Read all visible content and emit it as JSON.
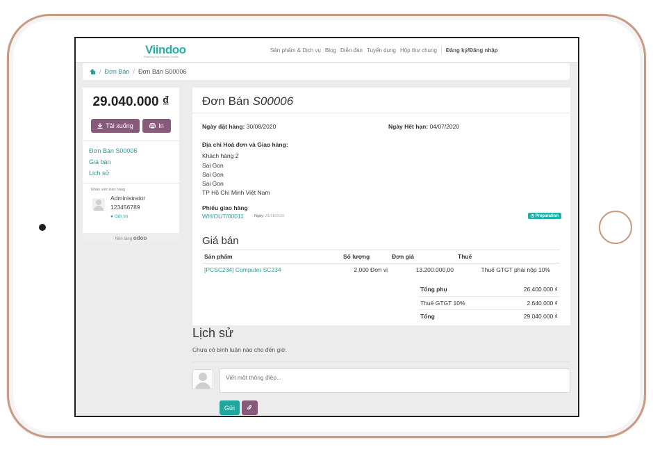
{
  "nav": {
    "logo": "Viindoo",
    "tagline": "Powering Your Business Growth",
    "links": [
      "Sản phẩm & Dịch vụ",
      "Blog",
      "Diễn đàn",
      "Tuyển dụng",
      "Hộp thư chung"
    ],
    "login": "Đăng ký/Đăng nhập"
  },
  "breadcrumb": {
    "parent": "Đơn Bán",
    "current": "Đơn Bán S00006"
  },
  "sidebar": {
    "amount": "29.040.000 ₫",
    "download_label": "Tải xuống",
    "print_label": "In",
    "links": [
      "Đơn Bán S00006",
      "Giá bán",
      "Lịch sử"
    ],
    "salesperson_label": "Nhân viên bán hàng",
    "salesperson_name": "Administrator",
    "salesperson_phone": "123456789",
    "chat_label": "Gửi tin",
    "powered_by": "Nền tảng",
    "powered_brand": "odoo"
  },
  "order": {
    "title_prefix": "Đơn Bán",
    "title_number": "S00006",
    "order_date_label": "Ngày đặt hàng:",
    "order_date": "30/08/2020",
    "expiry_label": "Ngày Hết hạn:",
    "expiry_date": "04/07/2020",
    "address_label": "Địa chỉ Hoá đơn và Giao hàng:",
    "address_lines": [
      "Khách hàng 2",
      "Sai Gon",
      "Sai Gon",
      "Sai Gon",
      "TP Hồ Chí Minh Việt Nam"
    ],
    "delivery_label": "Phiếu giao hàng",
    "delivery_ref": "WH/OUT/00011",
    "delivery_date_label": "Ngày:",
    "delivery_date": "31/08/2020",
    "delivery_status": "Preparation",
    "pricing_title": "Giá bán",
    "columns": [
      "Sản phẩm",
      "Số lượng",
      "Đơn giá",
      "Thuế"
    ],
    "lines": [
      {
        "product": "[PCSC234] Computer SC234",
        "qty": "2,000 Đơn vị",
        "price": "13.200.000,00",
        "tax": "Thuế GTGT phải nộp 10%"
      }
    ],
    "subtotal_label": "Tổng phụ",
    "subtotal": "26.400.000 ₫",
    "tax_label": "Thuế GTGT 10%",
    "tax": "2.640.000 ₫",
    "total_label": "Tổng",
    "total": "29.040.000 ₫"
  },
  "history": {
    "title": "Lịch sử",
    "empty": "Chưa có bình luận nào cho đến giờ.",
    "placeholder": "Viết một thông điệp...",
    "send_label": "Gửi"
  },
  "colors": {
    "primary": "#875a7b",
    "teal": "#2a9d96",
    "frame": "#c89a82"
  }
}
